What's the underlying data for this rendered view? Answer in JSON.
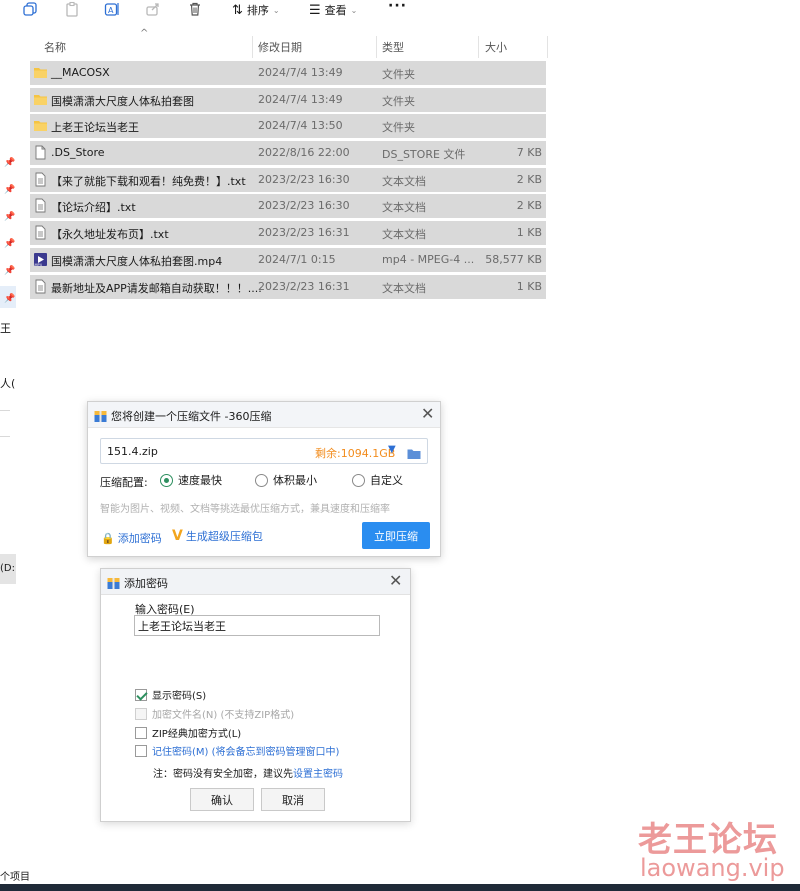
{
  "toolbar": {
    "icons": [
      "copy-icon",
      "paste-icon",
      "rename-icon",
      "share-icon",
      "delete-icon"
    ],
    "sort_label": "排序",
    "view_label": "查看",
    "more_label": "···"
  },
  "columns": {
    "name": "名称",
    "date": "修改日期",
    "type": "类型",
    "size": "大小"
  },
  "files": [
    {
      "name": "__MACOSX",
      "date": "2024/7/4 13:49",
      "type": "文件夹",
      "size": "",
      "icon": "folder-icon"
    },
    {
      "name": "国模潇潇大尺度人体私拍套图",
      "date": "2024/7/4 13:49",
      "type": "文件夹",
      "size": "",
      "icon": "folder-icon"
    },
    {
      "name": "上老王论坛当老王",
      "date": "2024/7/4 13:50",
      "type": "文件夹",
      "size": "",
      "icon": "folder-icon"
    },
    {
      "name": ".DS_Store",
      "date": "2022/8/16 22:00",
      "type": "DS_STORE 文件",
      "size": "7 KB",
      "icon": "file-icon"
    },
    {
      "name": "【来了就能下载和观看！纯免费！】.txt",
      "date": "2023/2/23 16:30",
      "type": "文本文档",
      "size": "2 KB",
      "icon": "text-file-icon"
    },
    {
      "name": "【论坛介绍】.txt",
      "date": "2023/2/23 16:30",
      "type": "文本文档",
      "size": "2 KB",
      "icon": "text-file-icon"
    },
    {
      "name": "【永久地址发布页】.txt",
      "date": "2023/2/23 16:31",
      "type": "文本文档",
      "size": "1 KB",
      "icon": "text-file-icon"
    },
    {
      "name": "国模潇潇大尺度人体私拍套图.mp4",
      "date": "2024/7/1 0:15",
      "type": "mp4 - MPEG-4 ...",
      "size": "58,577 KB",
      "icon": "video-file-icon"
    },
    {
      "name": "最新地址及APP请发邮箱自动获取！！！....",
      "date": "2023/2/23 16:31",
      "type": "文本文档",
      "size": "1 KB",
      "icon": "text-file-icon"
    }
  ],
  "left_strip": {
    "text_1": "王",
    "text_2": "人(",
    "drive": "(D:",
    "status": "个项目"
  },
  "compress_dialog": {
    "title": "您将创建一个压缩文件 -360压缩",
    "filename": "151.4.zip",
    "free_space": "剩余:1094.1GB",
    "config_label": "压缩配置:",
    "options": [
      "速度最快",
      "体积最小",
      "自定义"
    ],
    "selected_option": "速度最快",
    "hint": "智能为图片、视频、文档等挑选最优压缩方式，兼具速度和压缩率",
    "add_password": "添加密码",
    "super_package": "生成超级压缩包",
    "compress_button": "立即压缩"
  },
  "password_dialog": {
    "title": "添加密码",
    "input_label": "输入密码(E)",
    "password_value": "上老王论坛当老王",
    "checkboxes": [
      {
        "label": "显示密码(S)",
        "checked": true,
        "disabled": false
      },
      {
        "label": "加密文件名(N) (不支持ZIP格式)",
        "checked": false,
        "disabled": true
      },
      {
        "label": "ZIP经典加密方式(L)",
        "checked": false,
        "disabled": false
      },
      {
        "label": "记住密码(M) (将会备忘到密码管理窗口中)",
        "checked": false,
        "disabled": false
      }
    ],
    "note_prefix": "注：密码没有安全加密，建议先",
    "note_link": "设置主密码",
    "ok_button": "确认",
    "cancel_button": "取消"
  },
  "watermark": {
    "line1": "老王论坛",
    "line2": "laowang.vip"
  },
  "colors": {
    "row_highlight": "#d9d9d9",
    "accent_blue": "#2a8df0",
    "link_blue": "#2d6fd4",
    "free_space_orange": "#f28c1d",
    "radio_green": "#2d8f5f",
    "watermark": "#ec9a9a"
  }
}
